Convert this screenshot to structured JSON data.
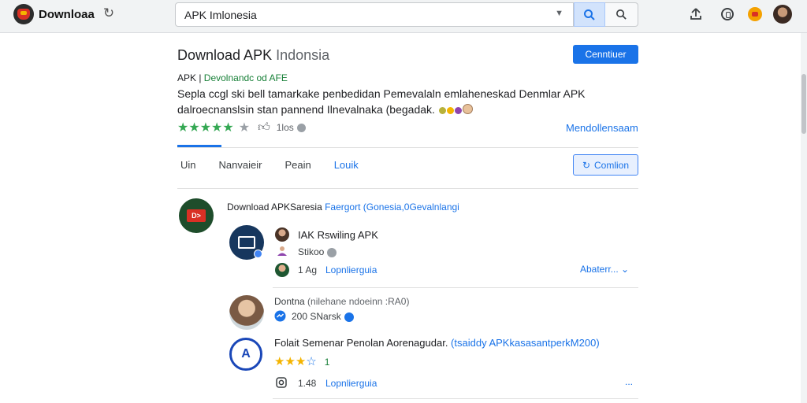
{
  "topbar": {
    "app_title": "Downloaa",
    "search_value": "APK Imlonesia",
    "icons": [
      "app-logo-icon",
      "reload-icon",
      "dropdown-caret-icon",
      "search-icon",
      "share-icon",
      "info-circle-icon",
      "badge-icon",
      "avatar"
    ]
  },
  "header": {
    "title_bold": "Download APK",
    "title_thin": " Indonsia",
    "primary_button": "Cenntiuer",
    "subtitle_prefix": "APK | ",
    "subtitle_green": "Devolnandc od AFE",
    "description": "Sepla ccgl ski bell tamarkake penbedidan Pemevalaln emlaheneskad Denmlar APK dalroecnanslsin stan pannend Ilnevalnaka (begadak.",
    "rating_count": "1los",
    "rating_link": "Mendollensaam"
  },
  "tabs": {
    "items": [
      "Uin",
      "Nanvaieir",
      "Peain",
      "Louik"
    ],
    "active_index": 3,
    "outline_button": "Comlion"
  },
  "feed": {
    "head_text": "Download APKSaresia ",
    "head_link": "Faergort (Gonesia,0Gevalnlangi",
    "post1": {
      "title": "IAK Rswiling APK",
      "meta": "Stikoo",
      "stat": "1 Ag",
      "stat_link": "Lopnlierguia",
      "more": "Abaterr..."
    },
    "post2": {
      "title": "Dontna ",
      "title_muted": "(nilehane ndoeinn :RA0)",
      "meta": "200 SNarsk",
      "body": "Folait Semenar Penolan Aorenagudar. ",
      "body_link": "(tsaiddy APKkasasantperkM200)",
      "rating_value": "1",
      "stat": "1.48",
      "stat_link": "Lopnlierguia",
      "more": "..."
    }
  },
  "colors": {
    "accent": "#1a73e8",
    "success": "#34a853",
    "star_yellow": "#f4b400",
    "text": "#202124"
  }
}
